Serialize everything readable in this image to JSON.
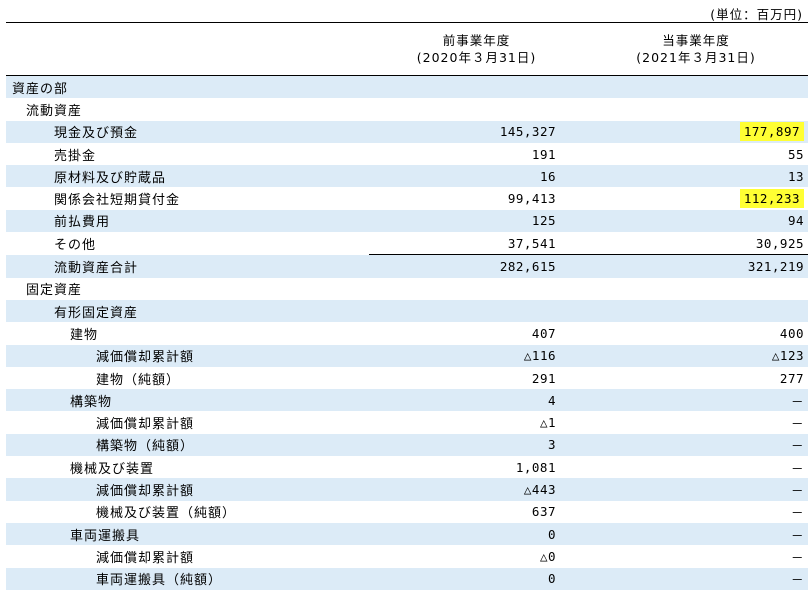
{
  "unit_note": "(単位：百万円)",
  "header": {
    "prev_title": "前事業年度",
    "prev_date": "(2020年３月31日)",
    "curr_title": "当事業年度",
    "curr_date": "(2021年３月31日)"
  },
  "colors": {
    "row_stripe": "#dcebf7",
    "highlight": "#ffff33"
  },
  "rows": [
    {
      "label": "資産の部",
      "level": 0,
      "prev": "",
      "curr": ""
    },
    {
      "label": "流動資産",
      "level": 1,
      "prev": "",
      "curr": ""
    },
    {
      "label": "現金及び預金",
      "level": 2,
      "prev": "145,327",
      "curr": "177,897",
      "highlight_curr": true
    },
    {
      "label": "売掛金",
      "level": 2,
      "prev": "191",
      "curr": "55"
    },
    {
      "label": "原材料及び貯蔵品",
      "level": 2,
      "prev": "16",
      "curr": "13"
    },
    {
      "label": "関係会社短期貸付金",
      "level": 2,
      "prev": "99,413",
      "curr": "112,233",
      "highlight_curr": true
    },
    {
      "label": "前払費用",
      "level": 2,
      "prev": "125",
      "curr": "94"
    },
    {
      "label": "その他",
      "level": 2,
      "prev": "37,541",
      "curr": "30,925"
    },
    {
      "label": "流動資産合計",
      "level": 2,
      "prev": "282,615",
      "curr": "321,219",
      "total": true
    },
    {
      "label": "固定資産",
      "level": 1,
      "prev": "",
      "curr": ""
    },
    {
      "label": "有形固定資産",
      "level": 2,
      "prev": "",
      "curr": ""
    },
    {
      "label": "建物",
      "level": 3,
      "prev": "407",
      "curr": "400"
    },
    {
      "label": "減価償却累計額",
      "level": 4,
      "prev": "△116",
      "curr": "△123"
    },
    {
      "label": "建物（純額）",
      "level": 4,
      "prev": "291",
      "curr": "277"
    },
    {
      "label": "構築物",
      "level": 3,
      "prev": "4",
      "curr": "－"
    },
    {
      "label": "減価償却累計額",
      "level": 4,
      "prev": "△1",
      "curr": "－"
    },
    {
      "label": "構築物（純額）",
      "level": 4,
      "prev": "3",
      "curr": "－"
    },
    {
      "label": "機械及び装置",
      "level": 3,
      "prev": "1,081",
      "curr": "－"
    },
    {
      "label": "減価償却累計額",
      "level": 4,
      "prev": "△443",
      "curr": "－"
    },
    {
      "label": "機械及び装置（純額）",
      "level": 4,
      "prev": "637",
      "curr": "－"
    },
    {
      "label": "車両運搬具",
      "level": 3,
      "prev": "0",
      "curr": "－"
    },
    {
      "label": "減価償却累計額",
      "level": 4,
      "prev": "△0",
      "curr": "－"
    },
    {
      "label": "車両運搬具（純額）",
      "level": 4,
      "prev": "0",
      "curr": "－"
    }
  ]
}
